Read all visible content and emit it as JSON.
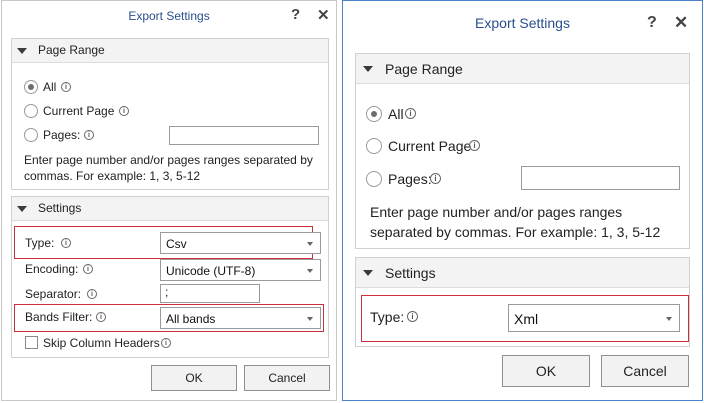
{
  "dialog_a": {
    "title": "Export Settings",
    "help_glyph": "?",
    "close_glyph": "✕",
    "page_range": {
      "header": "Page Range",
      "all_label": "All",
      "current_page_label": "Current Page",
      "pages_label": "Pages:",
      "pages_value": "",
      "help_text": "Enter page number and/or pages ranges separated by commas. For example: 1, 3, 5-12",
      "selected": "All"
    },
    "settings": {
      "header": "Settings",
      "type_label": "Type:",
      "type_value": "Csv",
      "encoding_label": "Encoding:",
      "encoding_value": "Unicode (UTF-8)",
      "separator_label": "Separator:",
      "separator_value": ";",
      "bands_filter_label": "Bands Filter:",
      "bands_filter_value": "All bands",
      "skip_headers_label": "Skip Column Headers",
      "skip_headers_checked": false
    },
    "ok_label": "OK",
    "cancel_label": "Cancel"
  },
  "dialog_b": {
    "title": "Export Settings",
    "help_glyph": "?",
    "close_glyph": "✕",
    "page_range": {
      "header": "Page Range",
      "all_label": "All",
      "current_page_label": "Current Page",
      "pages_label": "Pages:",
      "pages_value": "",
      "help_text": "Enter page number and/or pages ranges separated by commas. For example: 1, 3, 5-12",
      "selected": "All"
    },
    "settings": {
      "header": "Settings",
      "type_label": "Type:",
      "type_value": "Xml"
    },
    "ok_label": "OK",
    "cancel_label": "Cancel"
  },
  "colors": {
    "title_text": "#2a4f8f",
    "highlight_border": "#c9303b",
    "active_dialog_border": "#4a82c8"
  },
  "icons": [
    "collapse-arrow-icon",
    "info-icon",
    "dropdown-arrow-icon",
    "help-icon",
    "close-icon"
  ]
}
